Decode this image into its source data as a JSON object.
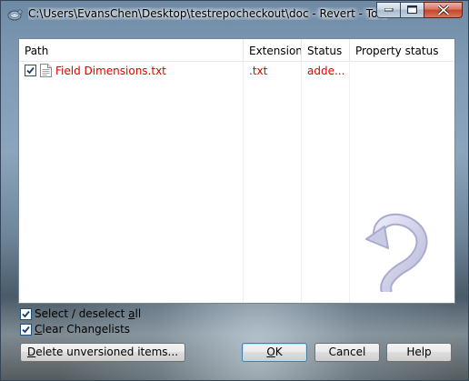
{
  "window": {
    "title": "C:\\Users\\EvansChen\\Desktop\\testrepocheckout\\doc - Revert - TortoiseSVN",
    "icon": "tortoisesvn-icon",
    "caption_buttons": [
      "minimize",
      "maximize",
      "close"
    ]
  },
  "file_list": {
    "columns": [
      "Path",
      "Extension",
      "Status",
      "Property status"
    ],
    "rows": [
      {
        "checked": true,
        "path": "Field Dimensions.txt",
        "extension": ".txt",
        "status": "adde...",
        "property_status": ""
      }
    ]
  },
  "options": {
    "select_all": {
      "label_before": "Select / deselect ",
      "label_mnemonic": "a",
      "label_after": "ll",
      "checked": true
    },
    "clear_changelists": {
      "label_before": "",
      "label_mnemonic": "C",
      "label_after": "lear Changelists",
      "checked": true
    }
  },
  "buttons": {
    "delete_unversioned": {
      "mnemonic": "D",
      "rest": "elete unversioned items..."
    },
    "ok": {
      "mnemonic": "O",
      "rest": "K"
    },
    "cancel": "Cancel",
    "help": "Help"
  },
  "colors": {
    "modified_text": "#e00000",
    "checkbox_border": "#1c5180",
    "default_button_border": "#3c7fb1"
  }
}
